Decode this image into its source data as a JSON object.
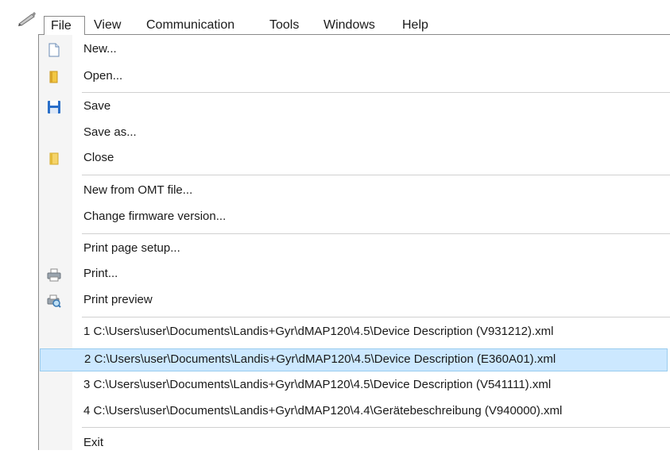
{
  "menubar": {
    "items": [
      "File",
      "View",
      "Communication",
      "Tools",
      "Windows",
      "Help"
    ]
  },
  "file_menu": {
    "new": "New...",
    "open": "Open...",
    "save": "Save",
    "save_as": "Save as...",
    "close": "Close",
    "new_from_omt": "New from OMT file...",
    "change_firmware": "Change firmware version...",
    "print_setup": "Print page setup...",
    "print": "Print...",
    "print_preview": "Print preview",
    "recent": [
      "1 C:\\Users\\user\\Documents\\Landis+Gyr\\dMAP120\\4.5\\Device Description (V931212).xml",
      "2 C:\\Users\\user\\Documents\\Landis+Gyr\\dMAP120\\4.5\\Device Description (E360A01).xml",
      "3 C:\\Users\\user\\Documents\\Landis+Gyr\\dMAP120\\4.5\\Device Description (V541111).xml",
      "4 C:\\Users\\user\\Documents\\Landis+Gyr\\dMAP120\\4.4\\Gerätebeschreibung (V940000).xml"
    ],
    "exit": "Exit"
  },
  "icons": {
    "app": "pen-icon",
    "new": "new-document-icon",
    "open": "open-folder-icon",
    "save": "floppy-disk-icon",
    "close": "close-folder-icon",
    "print": "printer-icon",
    "print_preview": "print-preview-icon"
  },
  "colors": {
    "highlight": "#cce8ff",
    "highlight_border": "#99ccee",
    "save_blue": "#2a6fc9",
    "folder_yellow": "#f2c744"
  }
}
